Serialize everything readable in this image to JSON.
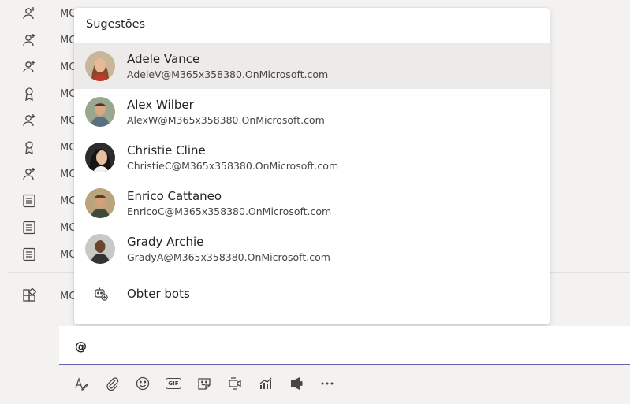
{
  "feed": {
    "rows": [
      {
        "icon": "person-add-icon",
        "text": "MC"
      },
      {
        "icon": "person-add-icon",
        "text": "MC"
      },
      {
        "icon": "person-add-icon",
        "text": "MC"
      },
      {
        "icon": "ribbon-icon",
        "text": "MC"
      },
      {
        "icon": "person-add-icon",
        "text": "MC"
      },
      {
        "icon": "ribbon-icon",
        "text": "MC"
      },
      {
        "icon": "person-add-icon",
        "text": "MC"
      },
      {
        "icon": "list-icon",
        "text": "MC"
      },
      {
        "icon": "list-icon",
        "text": "MC"
      },
      {
        "icon": "list-icon",
        "text": "MC"
      },
      {
        "icon": "apps-icon",
        "text": "MC"
      }
    ]
  },
  "suggestions": {
    "title": "Sugestões",
    "people": [
      {
        "name": "Adele Vance",
        "email": "AdeleV@M365x358380.OnMicrosoft.com",
        "selected": true
      },
      {
        "name": "Alex Wilber",
        "email": "AlexW@M365x358380.OnMicrosoft.com"
      },
      {
        "name": "Christie Cline",
        "email": "ChristieC@M365x358380.OnMicrosoft.com"
      },
      {
        "name": "Enrico Cattaneo",
        "email": "EnricoC@M365x358380.OnMicrosoft.com"
      },
      {
        "name": "Grady Archie",
        "email": "GradyA@M365x358380.OnMicrosoft.com"
      }
    ],
    "get_bots_label": "Obter bots"
  },
  "compose": {
    "text": "@"
  },
  "toolbar": {
    "gif_label": "GIF",
    "buttons": [
      "format-icon",
      "attach-icon",
      "emoji-icon",
      "gif-icon",
      "sticker-icon",
      "meet-now-icon",
      "praise-icon",
      "stream-icon",
      "more-options-icon"
    ]
  },
  "colors": {
    "accent": "#6264a7",
    "background": "#f3f2f1",
    "selected_row": "#edebe9"
  }
}
